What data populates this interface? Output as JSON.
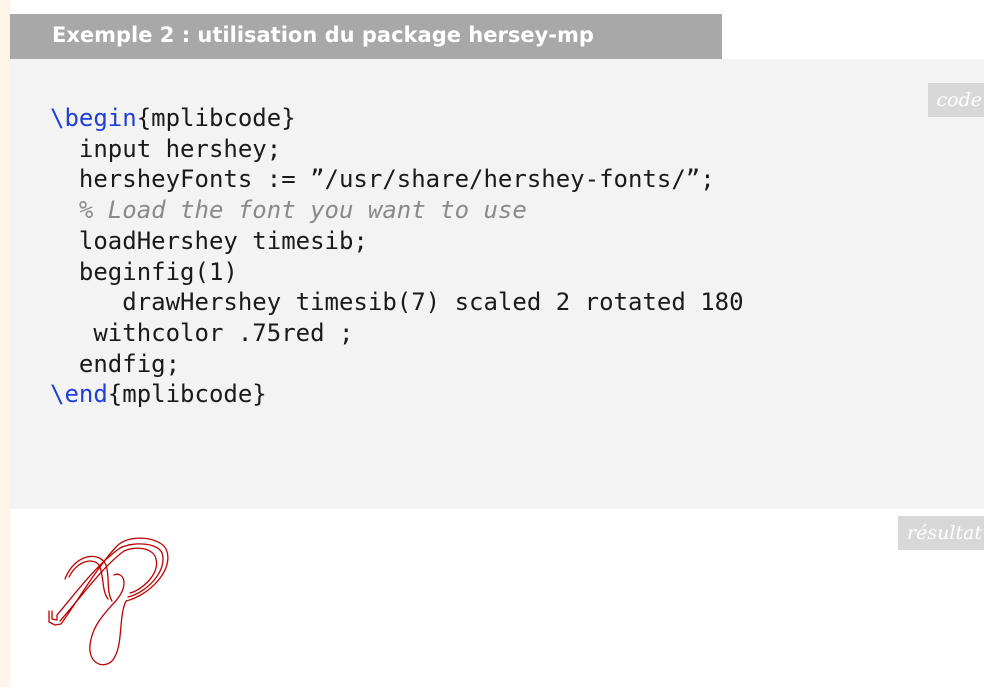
{
  "header": {
    "title": "Exemple 2 : utilisation du package hersey-mp"
  },
  "code_panel": {
    "tag": "code",
    "lines": [
      {
        "kw": "\\begin",
        "rest": "{mplibcode}"
      },
      {
        "text": "  input hershey;"
      },
      {
        "text": "  hersheyFonts := ”/usr/share/hershey-fonts/”;"
      },
      {
        "comment": "  % Load the font you want to use"
      },
      {
        "text": "  loadHershey timesib;"
      },
      {
        "text": "  beginfig(1)"
      },
      {
        "text": "     drawHershey timesib(7) scaled 2 rotated 180"
      },
      {
        "text": "   withcolor .75red ;"
      },
      {
        "text": "  endfig;"
      },
      {
        "kw": "\\end",
        "rest": "{mplibcode}"
      }
    ]
  },
  "result_panel": {
    "tag": "résultat",
    "glyph": "hershey-timesib-7-rotated-180",
    "stroke_color": "#bf0000"
  }
}
